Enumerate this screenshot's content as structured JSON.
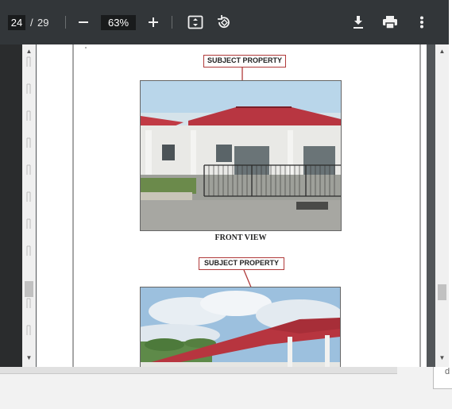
{
  "toolbar": {
    "page_current": "24",
    "page_separator": "/",
    "page_total": "29",
    "zoom": "63%",
    "icons": [
      "minus-icon",
      "plus-icon",
      "fit-page-icon",
      "rotate-icon",
      "download-icon",
      "print-icon",
      "more-vert-icon"
    ]
  },
  "document": {
    "photo1_label": "SUBJECT PROPERTY",
    "photo1_caption": "FRONT VIEW",
    "photo2_label": "SUBJECT PROPERTY"
  },
  "background": {
    "fragment_text": "d"
  },
  "colors": {
    "toolbar_bg": "#323639",
    "viewer_bg": "#525659",
    "label_border": "#b03a3a",
    "roof": "#b3333a"
  }
}
